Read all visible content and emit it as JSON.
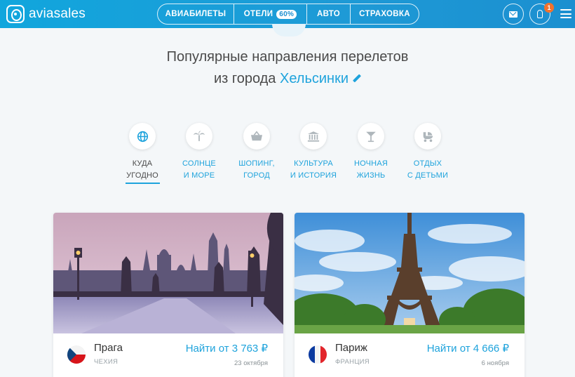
{
  "header": {
    "logo": "aviasales",
    "nav": [
      {
        "label": "АВИАБИЛЕТЫ"
      },
      {
        "label": "ОТЕЛИ",
        "badge": "60%"
      },
      {
        "label": "АВТО"
      },
      {
        "label": "СТРАХОВКА"
      }
    ],
    "notification_count": "1"
  },
  "hero": {
    "line1": "Популярные направления перелетов",
    "line2_prefix": "из города",
    "city": "Хельсинки"
  },
  "categories": [
    {
      "line1": "КУДА",
      "line2": "УГОДНО",
      "icon": "globe-icon",
      "active": true
    },
    {
      "line1": "СОЛНЦЕ",
      "line2": "И МОРЕ",
      "icon": "palm-icon",
      "active": false
    },
    {
      "line1": "ШОПИНГ,",
      "line2": "ГОРОД",
      "icon": "basket-icon",
      "active": false
    },
    {
      "line1": "КУЛЬТУРА",
      "line2": "И ИСТОРИЯ",
      "icon": "museum-icon",
      "active": false
    },
    {
      "line1": "НОЧНАЯ",
      "line2": "ЖИЗНЬ",
      "icon": "cocktail-icon",
      "active": false
    },
    {
      "line1": "ОТДЫХ",
      "line2": "С ДЕТЬМИ",
      "icon": "stroller-icon",
      "active": false
    }
  ],
  "cards": [
    {
      "city": "Прага",
      "country": "ЧЕХИЯ",
      "price": "Найти от 3 763 ₽",
      "date": "23 октября",
      "flag": "cz-flag"
    },
    {
      "city": "Париж",
      "country": "ФРАНЦИЯ",
      "price": "Найти от 4 666 ₽",
      "date": "6 ноября",
      "flag": "fr-flag"
    }
  ],
  "colors": {
    "brand": "#1b8fd0",
    "accent": "#1ea3dc",
    "badge": "#f3722c"
  }
}
